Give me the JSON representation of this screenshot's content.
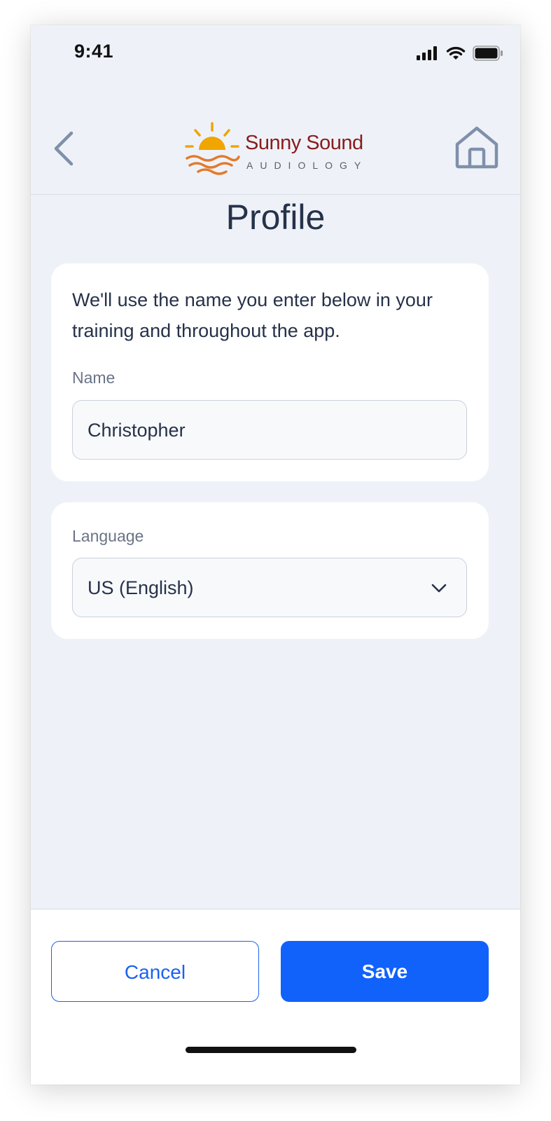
{
  "status_bar": {
    "time": "9:41",
    "icons": [
      "signal-icon",
      "wifi-icon",
      "battery-icon"
    ]
  },
  "header": {
    "back_icon": "chevron-left-icon",
    "home_icon": "home-icon",
    "logo": {
      "name": "Sunny Sound",
      "tagline": "AUDIOLOGY"
    }
  },
  "page": {
    "title": "Profile"
  },
  "name_card": {
    "description": "We'll use the name you enter below in your training and throughout the app.",
    "label": "Name",
    "value": "Christopher"
  },
  "language_card": {
    "label": "Language",
    "selected": "US (English)",
    "dropdown_icon": "chevron-down-icon"
  },
  "footer": {
    "cancel_label": "Cancel",
    "save_label": "Save"
  },
  "colors": {
    "accent": "#1062fb",
    "background": "#eef2f8",
    "text": "#26324a",
    "logo_red": "#8a1c1c",
    "logo_sun": "#f0a500"
  }
}
